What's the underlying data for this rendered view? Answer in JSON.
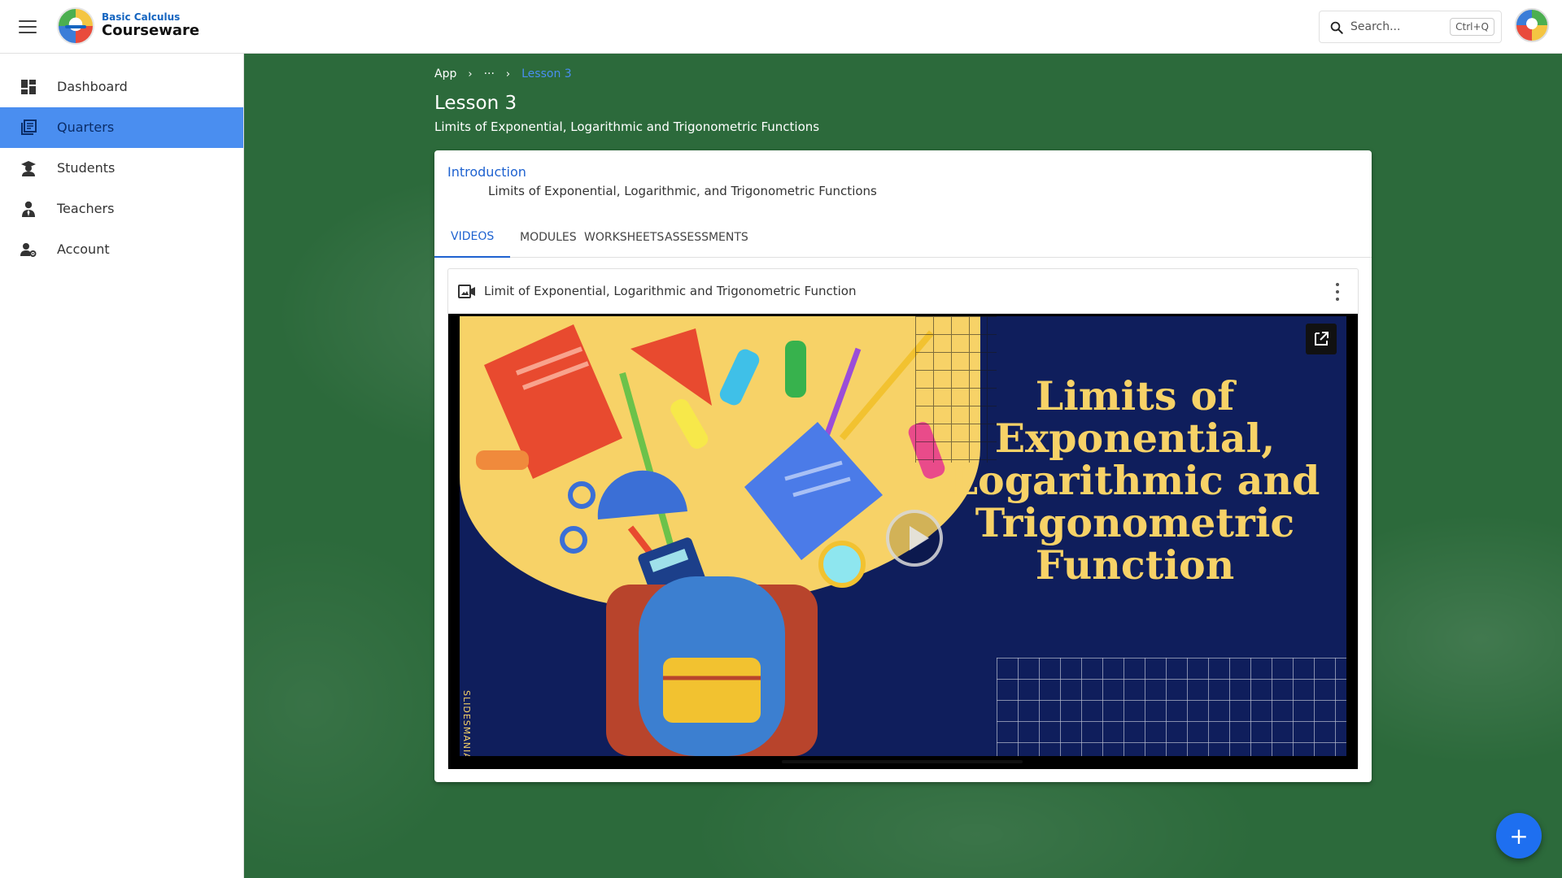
{
  "app": {
    "brand_sub": "Basic Calculus",
    "brand_main": "Courseware",
    "search_placeholder": "Search...",
    "search_shortcut": "Ctrl+Q",
    "menu_icon": "hamburger-icon",
    "avatar_icon": "user-avatar"
  },
  "sidebar": {
    "items": [
      {
        "label": "Dashboard",
        "icon": "dashboard-icon",
        "active": false
      },
      {
        "label": "Quarters",
        "icon": "library-books-icon",
        "active": true
      },
      {
        "label": "Students",
        "icon": "student-icon",
        "active": false
      },
      {
        "label": "Teachers",
        "icon": "teacher-icon",
        "active": false
      },
      {
        "label": "Account",
        "icon": "account-settings-icon",
        "active": false
      }
    ]
  },
  "breadcrumb": {
    "items": [
      "App",
      "···",
      "Lesson 3"
    ]
  },
  "page": {
    "title": "Lesson 3",
    "subtitle": "Limits of Exponential, Logarithmic and Trigonometric Functions"
  },
  "card": {
    "intro_link": "Introduction",
    "intro_desc": "Limits of Exponential, Logarithmic, and Trigonometric Functions",
    "tabs": [
      "VIDEOS",
      "MODULES",
      "WORKSHEETS",
      "ASSESSMENTS"
    ],
    "active_tab": "VIDEOS"
  },
  "video": {
    "title": "Limit of Exponential, Logarithmic and Trigonometric Function",
    "thumbnail_title": "Limits of Exponential, Logarithmic and Trigonometric Function",
    "watermark": "SLIDESMANIA.COM"
  },
  "fab": {
    "label": "+"
  },
  "colors": {
    "accent": "#4a8ef0",
    "link": "#1e62d0",
    "chalkboard": "#2c6a3b",
    "thumb_bg": "#0f1e5c",
    "thumb_text": "#f7d267",
    "fab": "#1e6ff0"
  }
}
